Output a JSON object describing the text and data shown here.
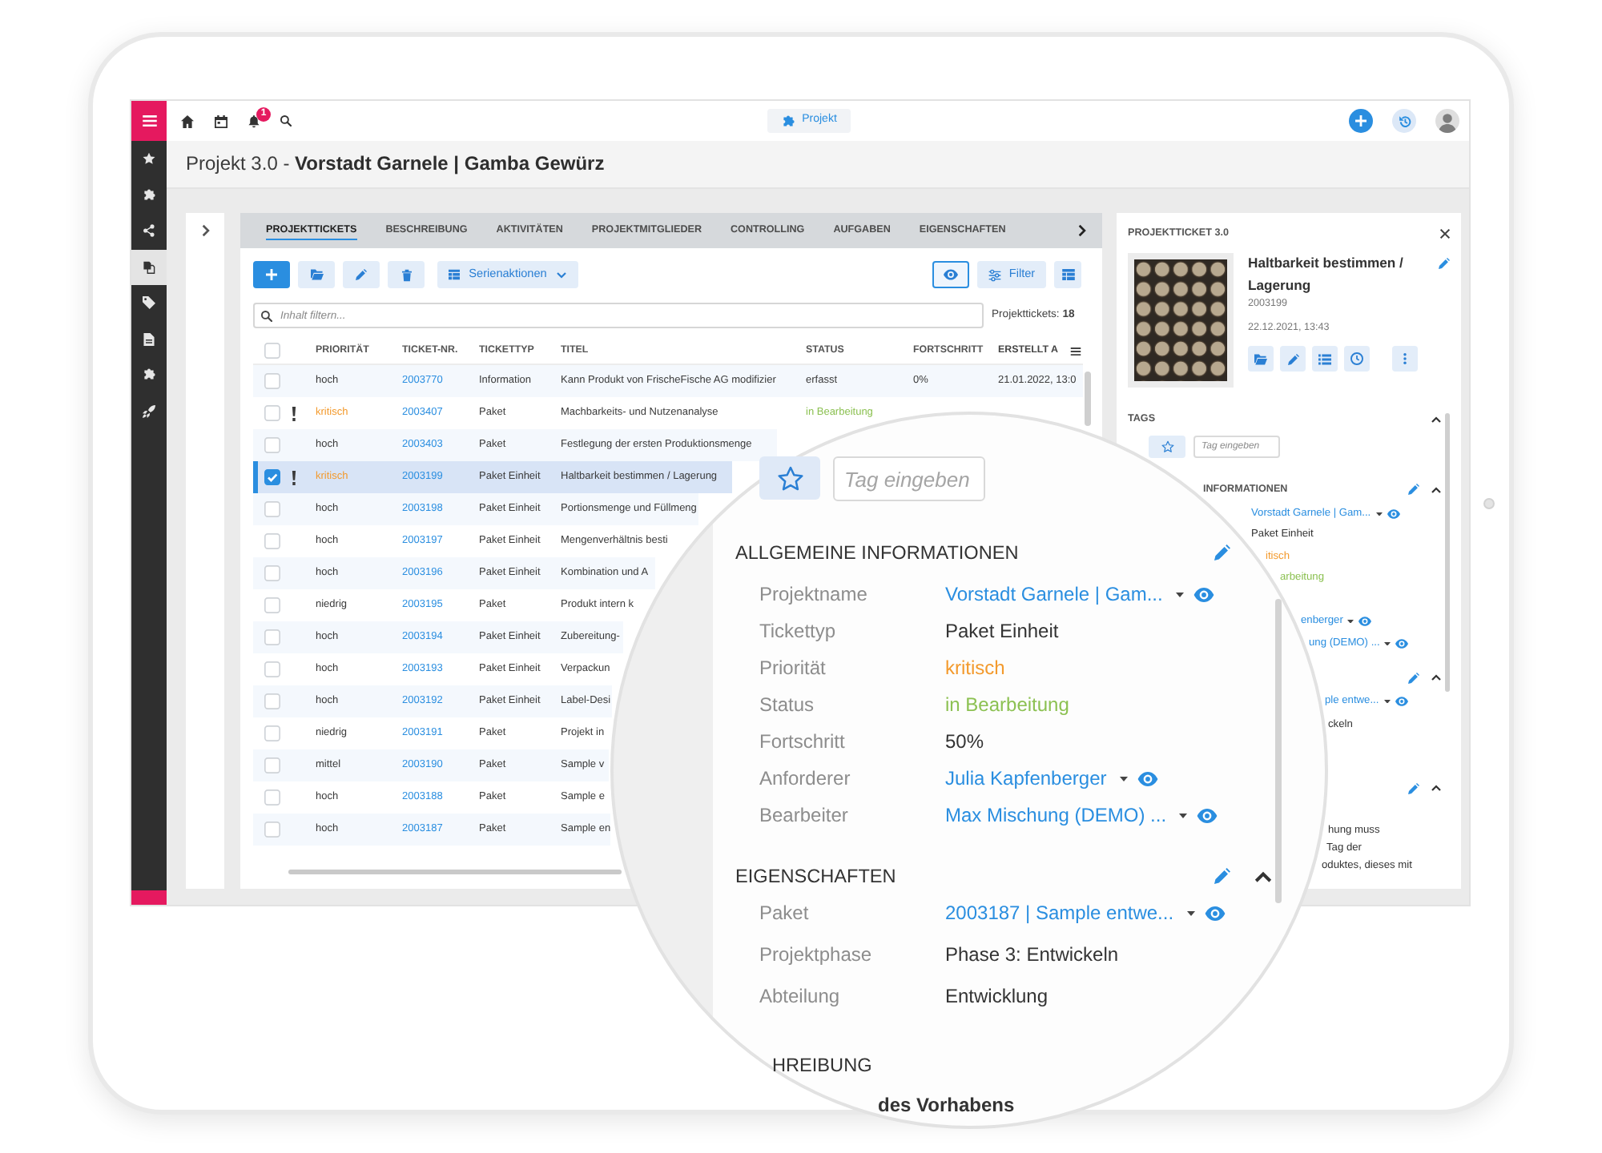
{
  "sidebar": {
    "items": [
      {
        "selected": false
      },
      {
        "selected": false
      },
      {
        "selected": false
      },
      {
        "selected": true
      },
      {
        "selected": false
      },
      {
        "selected": false
      },
      {
        "selected": false
      },
      {
        "selected": false
      }
    ]
  },
  "navbar": {
    "notifications": "1",
    "center_button": "Projekt"
  },
  "title": "Projekt 3.0 - **Vorstadt Garnele | Gamba Gewürz**",
  "tabs": [
    {
      "label": "PROJEKTTICKETS",
      "selected": true
    },
    {
      "label": "BESCHREIBUNG",
      "selected": false
    },
    {
      "label": "AKTIVITÄTEN",
      "selected": false
    },
    {
      "label": "PROJEKTMITGLIEDER",
      "selected": false
    },
    {
      "label": "CONTROLLING",
      "selected": false
    },
    {
      "label": "AUFGABEN",
      "selected": false
    },
    {
      "label": "EIGENSCHAFTEN",
      "selected": false
    }
  ],
  "toolbar": {
    "series_button": "Serienaktionen",
    "preview_on": true,
    "filter_button": "Filter"
  },
  "search": {
    "placeholder": "Inhalt filtern...",
    "count": "Projekttickets: **18**"
  },
  "table": {
    "all_checked": false,
    "columns": [
      "PRIORITÄT",
      "TICKET-NR.",
      "TICKETTYP",
      "TITEL",
      "STATUS",
      "FORTSCHRITT",
      "ERSTELLT A"
    ],
    "rows": [
      {
        "checked": false,
        "selected": false,
        "flagged": false,
        "priority": "hoch",
        "ticket": "2003770",
        "type": "Information",
        "title": "Kann Produkt von FrischeFische AG modifizier",
        "status": {
          "text": "erfasst",
          "color": "#3a3a3a"
        },
        "progress": "0%",
        "created": "21.01.2022, 13:0"
      },
      {
        "checked": false,
        "selected": false,
        "flagged": true,
        "priority": "kritisch",
        "ticket": "2003407",
        "type": "Paket",
        "title": "Machbarkeits- und Nutzenanalyse",
        "status": {
          "text": "in Bearbeitung",
          "color": "#8cc152"
        }
      },
      {
        "checked": false,
        "selected": false,
        "flagged": false,
        "priority": "hoch",
        "ticket": "2003403",
        "type": "Paket",
        "title": "Festlegung der ersten Produktionsmenge"
      },
      {
        "checked": true,
        "selected": true,
        "flagged": true,
        "priority": "kritisch",
        "ticket": "2003199",
        "type": "Paket Einheit",
        "title": "Haltbarkeit bestimmen / Lagerung"
      },
      {
        "checked": false,
        "selected": false,
        "flagged": false,
        "priority": "hoch",
        "ticket": "2003198",
        "type": "Paket Einheit",
        "title": "Portionsmenge und Füllmeng"
      },
      {
        "checked": false,
        "selected": false,
        "flagged": false,
        "priority": "hoch",
        "ticket": "2003197",
        "type": "Paket Einheit",
        "title": "Mengenverhältnis besti"
      },
      {
        "checked": false,
        "selected": false,
        "flagged": false,
        "priority": "hoch",
        "ticket": "2003196",
        "type": "Paket Einheit",
        "title": "Kombination und A"
      },
      {
        "checked": false,
        "selected": false,
        "flagged": false,
        "priority": "niedrig",
        "ticket": "2003195",
        "type": "Paket",
        "title": "Produkt intern k"
      },
      {
        "checked": false,
        "selected": false,
        "flagged": false,
        "priority": "hoch",
        "ticket": "2003194",
        "type": "Paket Einheit",
        "title": "Zubereitung-"
      },
      {
        "checked": false,
        "selected": false,
        "flagged": false,
        "priority": "hoch",
        "ticket": "2003193",
        "type": "Paket Einheit",
        "title": "Verpackun"
      },
      {
        "checked": false,
        "selected": false,
        "flagged": false,
        "priority": "hoch",
        "ticket": "2003192",
        "type": "Paket Einheit",
        "title": "Label-Desi"
      },
      {
        "checked": false,
        "selected": false,
        "flagged": false,
        "priority": "niedrig",
        "ticket": "2003191",
        "type": "Paket",
        "title": "Projekt in"
      },
      {
        "checked": false,
        "selected": false,
        "flagged": false,
        "priority": "mittel",
        "ticket": "2003190",
        "type": "Paket",
        "title": "Sample v"
      },
      {
        "checked": false,
        "selected": false,
        "flagged": false,
        "priority": "hoch",
        "ticket": "2003188",
        "type": "Paket",
        "title": "Sample e"
      },
      {
        "checked": false,
        "selected": false,
        "flagged": false,
        "priority": "hoch",
        "ticket": "2003187",
        "type": "Paket",
        "title": "Sample en"
      }
    ]
  },
  "detail": {
    "heading": "PROJEKTTICKET 3.0",
    "title": "Haltbarkeit bestimmen / Lagerung",
    "number": "2003199",
    "date": "22.12.2021, 13:43",
    "tags": {
      "heading": "TAGS",
      "expanded": true,
      "placeholder": "Tag eingeben"
    },
    "sections": [
      {
        "heading": "INFORMATIONEN",
        "expanded": true,
        "values": [
          {
            "kind": "link",
            "text": "Vorstadt Garnele | Gam..."
          },
          {
            "kind": "text",
            "text": "Paket Einheit"
          },
          {
            "kind": "text",
            "text": "itisch",
            "color": "#f39a2d"
          },
          {
            "kind": "text",
            "text": "arbeitung",
            "color": "#8cc152"
          },
          {
            "kind": "link",
            "text": "enberger"
          },
          {
            "kind": "link",
            "text": "ung (DEMO) ..."
          }
        ]
      },
      {
        "expanded": true,
        "values": [
          {
            "kind": "link",
            "text": "ple entwe..."
          },
          {
            "kind": "text",
            "text": "ckeln"
          }
        ]
      },
      {
        "expanded": true,
        "lines": [
          "hung muss",
          "Tag der",
          "oduktes, dieses mit"
        ]
      }
    ]
  },
  "magnifier": {
    "tags": {
      "placeholder": "Tag eingeben"
    },
    "sections": [
      {
        "heading": "ALLGEMEINE INFORMATIONEN",
        "fields": [
          {
            "label": "Projektname",
            "kind": "link",
            "value": "Vorstadt Garnele | Gam..."
          },
          {
            "label": "Tickettyp",
            "kind": "text",
            "value": "Paket Einheit"
          },
          {
            "label": "Priorität",
            "kind": "text",
            "value": "kritisch",
            "color": "#f39a2d"
          },
          {
            "label": "Status",
            "kind": "text",
            "value": "in Bearbeitung",
            "color": "#8cc152"
          },
          {
            "label": "Fortschritt",
            "kind": "text",
            "value": "50%"
          },
          {
            "label": "Anforderer",
            "kind": "link",
            "value": "Julia Kapfenberger"
          },
          {
            "label": "Bearbeiter",
            "kind": "link",
            "value": "Max Mischung (DEMO) ..."
          }
        ]
      },
      {
        "heading": "EIGENSCHAFTEN",
        "expanded": true,
        "fields": [
          {
            "label": "Paket",
            "kind": "link",
            "value": "2003187 | Sample entwe..."
          },
          {
            "label": "Projektphase",
            "kind": "text",
            "value": "Phase 3: Entwickeln"
          },
          {
            "label": "Abteilung",
            "kind": "text",
            "value": "Entwicklung"
          }
        ]
      },
      {
        "heading": "HREIBUNG",
        "lines": [
          "des Vorhabens"
        ]
      }
    ]
  }
}
